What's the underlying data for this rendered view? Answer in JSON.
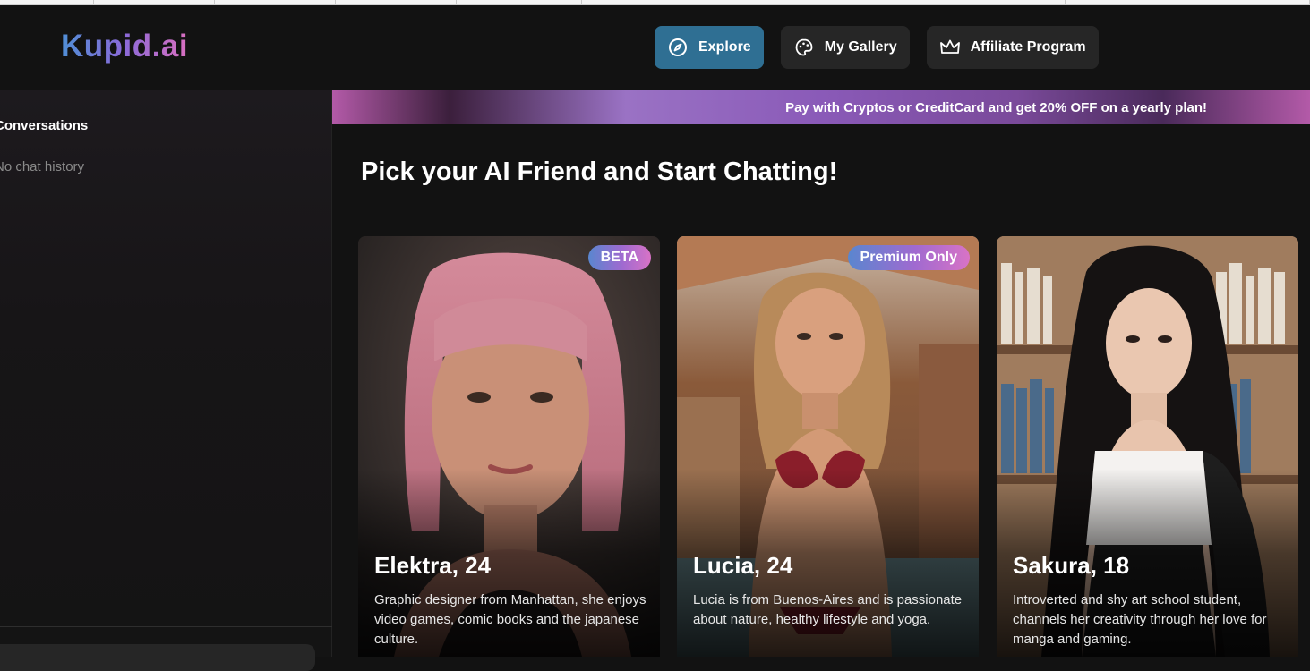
{
  "header": {
    "logo": "Kupid.ai",
    "nav": [
      {
        "label": "Explore",
        "icon": "compass-icon",
        "active": true
      },
      {
        "label": "My Gallery",
        "icon": "gallery-icon",
        "active": false
      },
      {
        "label": "Affiliate Program",
        "icon": "crown-icon",
        "active": false
      }
    ]
  },
  "sidebar": {
    "title": "Conversations",
    "empty_text": "No chat history"
  },
  "promo": {
    "text": "Pay with Cryptos or CreditCard and get 20% OFF on a yearly plan!"
  },
  "main": {
    "title": "Pick your AI Friend and Start Chatting!",
    "cards": [
      {
        "name": "Elektra, 24",
        "badge": "BETA",
        "description": "Graphic designer from Manhattan, she enjoys video games, comic books and the japanese culture."
      },
      {
        "name": "Lucia, 24",
        "badge": "Premium Only",
        "description": "Lucia is from Buenos-Aires and is passionate about nature, healthy lifestyle and yoga."
      },
      {
        "name": "Sakura, 18",
        "badge": "",
        "description": "Introverted and shy art school student, channels her creativity through her love for manga and gaming."
      }
    ]
  },
  "colors": {
    "background": "#121212",
    "nav_active": "#2f6f93",
    "nav_inactive": "#262626",
    "brand_gradient_start": "#4f8fd6",
    "brand_gradient_end": "#d96fc0"
  }
}
